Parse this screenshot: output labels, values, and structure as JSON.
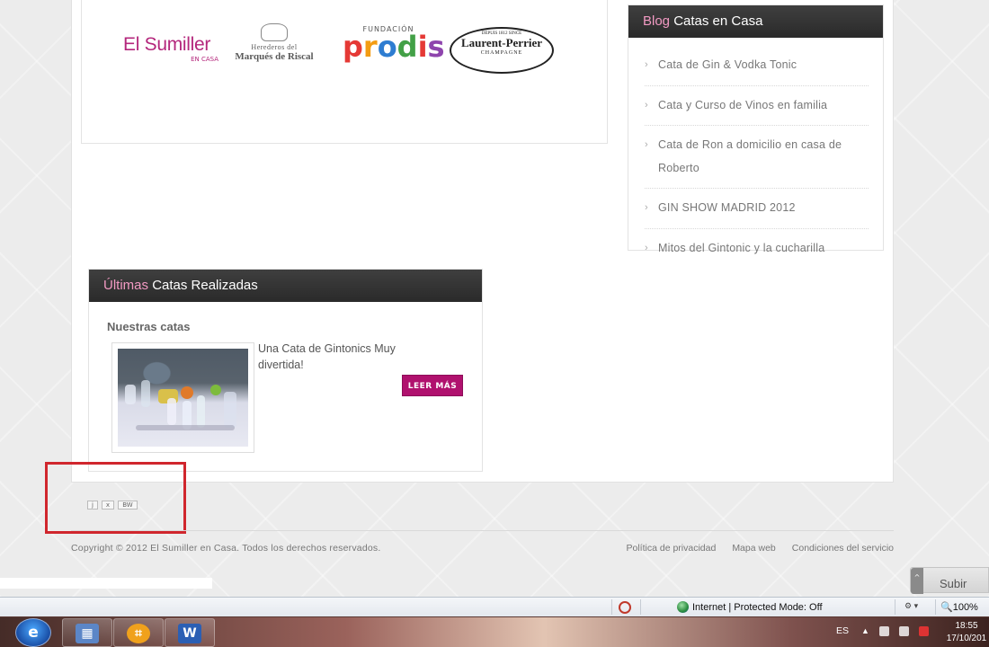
{
  "sponsors": {
    "sumiller": {
      "name": "El Sumiller",
      "sub": "EN CASA"
    },
    "marques": {
      "line1": "Herederos del",
      "line2": "Marqués de Riscal"
    },
    "prodis": {
      "foundation": "FUNDACIÓN",
      "name": "prodis"
    },
    "laurent": {
      "top": "DEPUIS 1812 SINCE",
      "name": "Laurent-Perrier",
      "bottom": "CHAMPAGNE"
    }
  },
  "blog": {
    "title_highlight": "Blog",
    "title_rest": "Catas en Casa",
    "items": [
      "Cata de Gin & Vodka Tonic",
      "Cata y Curso de Vinos en familia",
      "Cata de Ron a domicilio en casa de Roberto",
      "GIN SHOW MADRID 2012",
      "Mitos del Gintonic y la cucharilla"
    ]
  },
  "ultimas": {
    "title_highlight": "Últimas",
    "title_rest": "Catas Realizadas",
    "subtitle": "Nuestras catas",
    "caption": "Una Cata de Gintonics Muy divertida!",
    "button": "LEER MÁS"
  },
  "mini_buttons": [
    "j",
    "x",
    "BW"
  ],
  "footer": {
    "copyright": "Copyright © 2012 El Sumiller en Casa. Todos los derechos reservados.",
    "links": [
      "Política de privacidad",
      "Mapa web",
      "Condiciones del servicio"
    ]
  },
  "subir": "Subir",
  "statusbar": {
    "zone": "Internet | Protected Mode: Off",
    "zoom": "100%"
  },
  "taskbar": {
    "lang": "ES",
    "time": "18:55",
    "date": "17/10/201"
  },
  "colors": {
    "accent": "#b0116e",
    "header_bg": "#2f2f2f",
    "highlight_text": "#f29ac3",
    "annotation_box": "#d0262d"
  }
}
